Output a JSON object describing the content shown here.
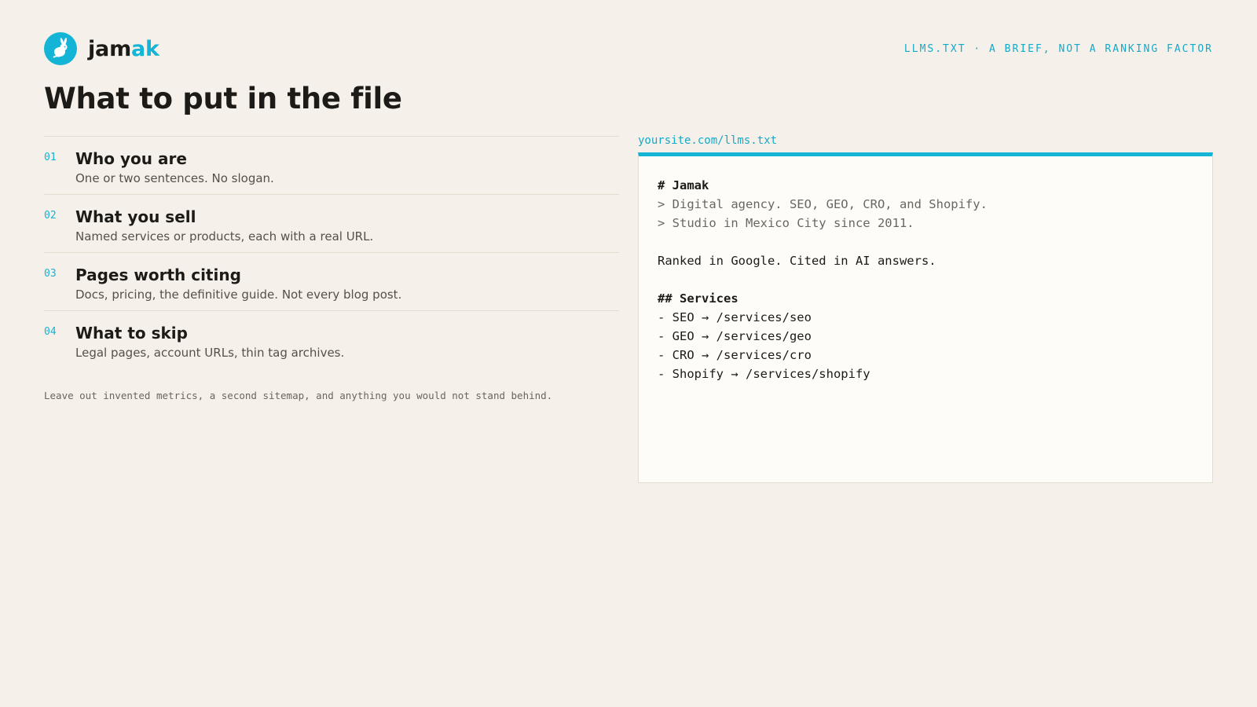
{
  "brand": {
    "name_prefix": "jam",
    "name_accent": "ak",
    "logo_icon": "rabbit-icon",
    "accent_color": "#14b4d6"
  },
  "tagline": "LLMS.TXT · A BRIEF, NOT A RANKING FACTOR",
  "page_title": "What to put in the file",
  "steps": [
    {
      "num": "01",
      "title": "Who you are",
      "desc": "One or two sentences. No slogan."
    },
    {
      "num": "02",
      "title": "What you sell",
      "desc": "Named services or products, each with a real URL."
    },
    {
      "num": "03",
      "title": "Pages worth citing",
      "desc": "Docs, pricing, the definitive guide. Not every blog post."
    },
    {
      "num": "04",
      "title": "What to skip",
      "desc": "Legal pages, account URLs, thin tag archives."
    }
  ],
  "footnote": "Leave out invented metrics, a second sitemap, and anything you would not stand behind.",
  "file": {
    "label": "yoursite.com/llms.txt",
    "lines": {
      "l1": "# Jamak",
      "l2": "> Digital agency. SEO, GEO, CRO, and Shopify.",
      "l3": "> Studio in Mexico City since 2011.",
      "l5": "Ranked in Google. Cited in AI answers.",
      "l7": "## Services",
      "l8": "- SEO → /services/seo",
      "l9": "- GEO → /services/geo",
      "l10": "- CRO → /services/cro",
      "l11": "- Shopify → /services/shopify"
    }
  }
}
